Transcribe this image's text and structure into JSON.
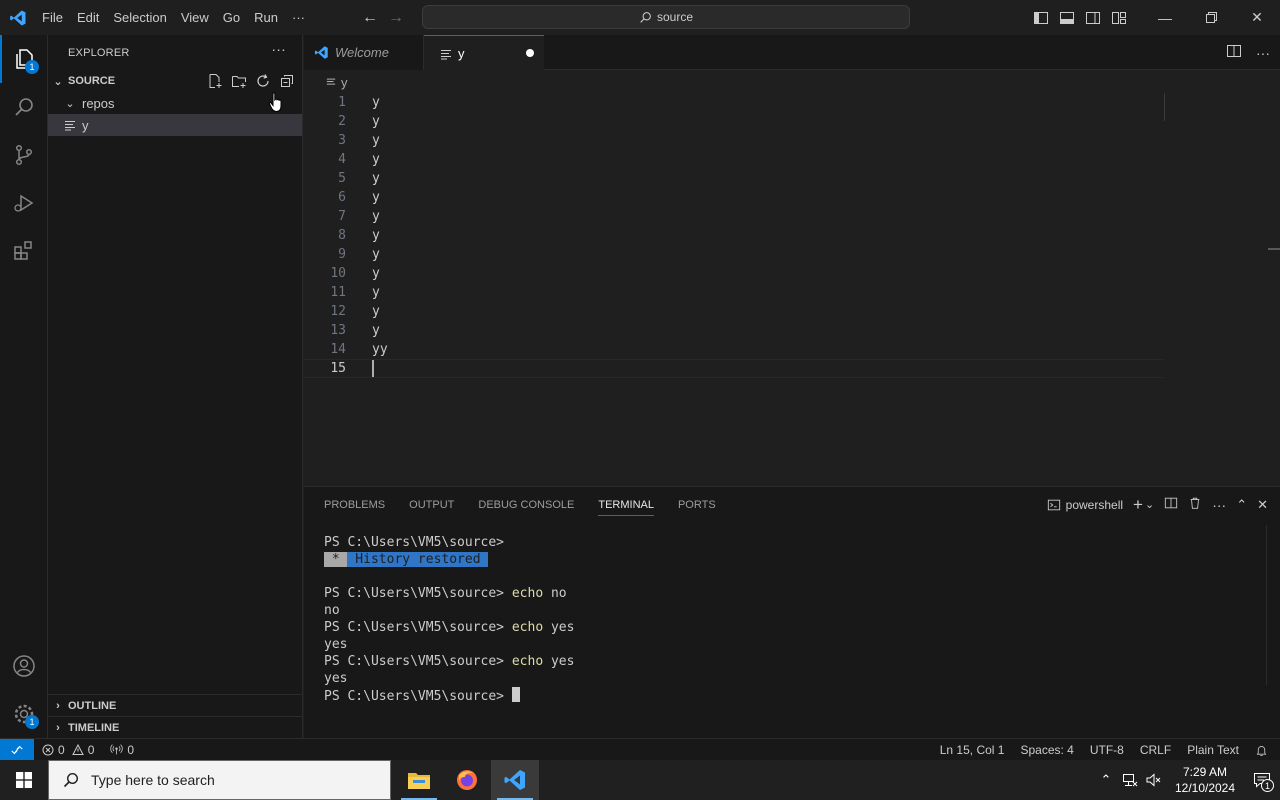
{
  "titlebar": {
    "menu": [
      "File",
      "Edit",
      "Selection",
      "View",
      "Go",
      "Run",
      "···"
    ],
    "search_text": "source"
  },
  "activitybar": {
    "explorer_badge": "1",
    "settings_badge": "1"
  },
  "sidebar": {
    "title": "EXPLORER",
    "more": "···",
    "section": "SOURCE",
    "tree": [
      {
        "type": "folder",
        "label": "repos"
      },
      {
        "type": "file",
        "label": "y"
      }
    ],
    "outline": "OUTLINE",
    "timeline": "TIMELINE"
  },
  "tabs": {
    "welcome": "Welcome",
    "active": "y"
  },
  "breadcrumb": "y",
  "editor": {
    "lines": [
      {
        "n": "1",
        "text": "y"
      },
      {
        "n": "2",
        "text": "y"
      },
      {
        "n": "3",
        "text": "y"
      },
      {
        "n": "4",
        "text": "y"
      },
      {
        "n": "5",
        "text": "y"
      },
      {
        "n": "6",
        "text": "y"
      },
      {
        "n": "7",
        "text": "y"
      },
      {
        "n": "8",
        "text": "y"
      },
      {
        "n": "9",
        "text": "y"
      },
      {
        "n": "10",
        "text": "y"
      },
      {
        "n": "11",
        "text": "y"
      },
      {
        "n": "12",
        "text": "y"
      },
      {
        "n": "13",
        "text": "y"
      },
      {
        "n": "14",
        "text": "yy"
      },
      {
        "n": "15",
        "text": ""
      }
    ]
  },
  "panel": {
    "tabs": [
      "PROBLEMS",
      "OUTPUT",
      "DEBUG CONSOLE",
      "TERMINAL",
      "PORTS"
    ],
    "active_tab": "TERMINAL",
    "shell": "powershell",
    "terminal": {
      "prompt": "PS C:\\Users\\VM5\\source>",
      "history_star": " * ",
      "history_text": " History restored ",
      "entries": [
        {
          "cmd": "echo",
          "arg": "no",
          "out": "no"
        },
        {
          "cmd": "echo",
          "arg": "yes",
          "out": "yes"
        },
        {
          "cmd": "echo",
          "arg": "yes",
          "out": "yes"
        }
      ]
    }
  },
  "statusbar": {
    "errors": "0",
    "warnings": "0",
    "ports": "0",
    "position": "Ln 15, Col 1",
    "spaces": "Spaces: 4",
    "encoding": "UTF-8",
    "eol": "CRLF",
    "language": "Plain Text"
  },
  "taskbar": {
    "search_placeholder": "Type here to search",
    "time": "7:29 AM",
    "date": "12/10/2024",
    "notif_count": "1"
  }
}
